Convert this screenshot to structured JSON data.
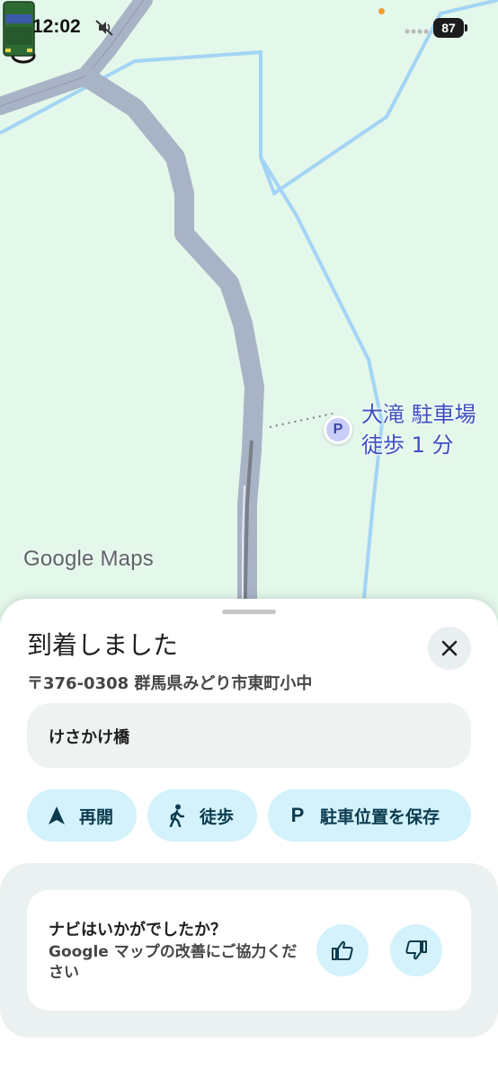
{
  "status_bar": {
    "time": "12:02",
    "battery": "87",
    "icons": [
      "mute-icon",
      "signal-icon",
      "battery-icon"
    ]
  },
  "map": {
    "parking_label_line1": "大滝 駐車場",
    "parking_label_line2": "徒歩 1 分",
    "parking_pin_letter": "P",
    "attribution": "Google Maps",
    "colors": {
      "land": "#e3f7ea",
      "road": "#a9b3c6",
      "river": "#a3d4f5",
      "route": "#7a7f8a",
      "parking_accent": "#3b4fbf"
    }
  },
  "sheet": {
    "title": "到着しました",
    "address": "〒376-0308 群馬県みどり市東町小中",
    "place_name": "けさかけ橋",
    "close_icon": "close-icon",
    "actions": [
      {
        "label": "再開",
        "icon": "navigation-arrow-icon"
      },
      {
        "label": "徒歩",
        "icon": "walking-person-icon"
      },
      {
        "label": "駐車位置を保存",
        "icon": "parking-icon",
        "icon_letter": "P"
      }
    ],
    "feedback": {
      "title": "ナビはいかがでしたか？",
      "subtitle": "Google マップの改善にご協力ください"
    },
    "colors": {
      "chip_bg": "#d3f2fb",
      "chip_text": "#0b3a4e"
    }
  }
}
